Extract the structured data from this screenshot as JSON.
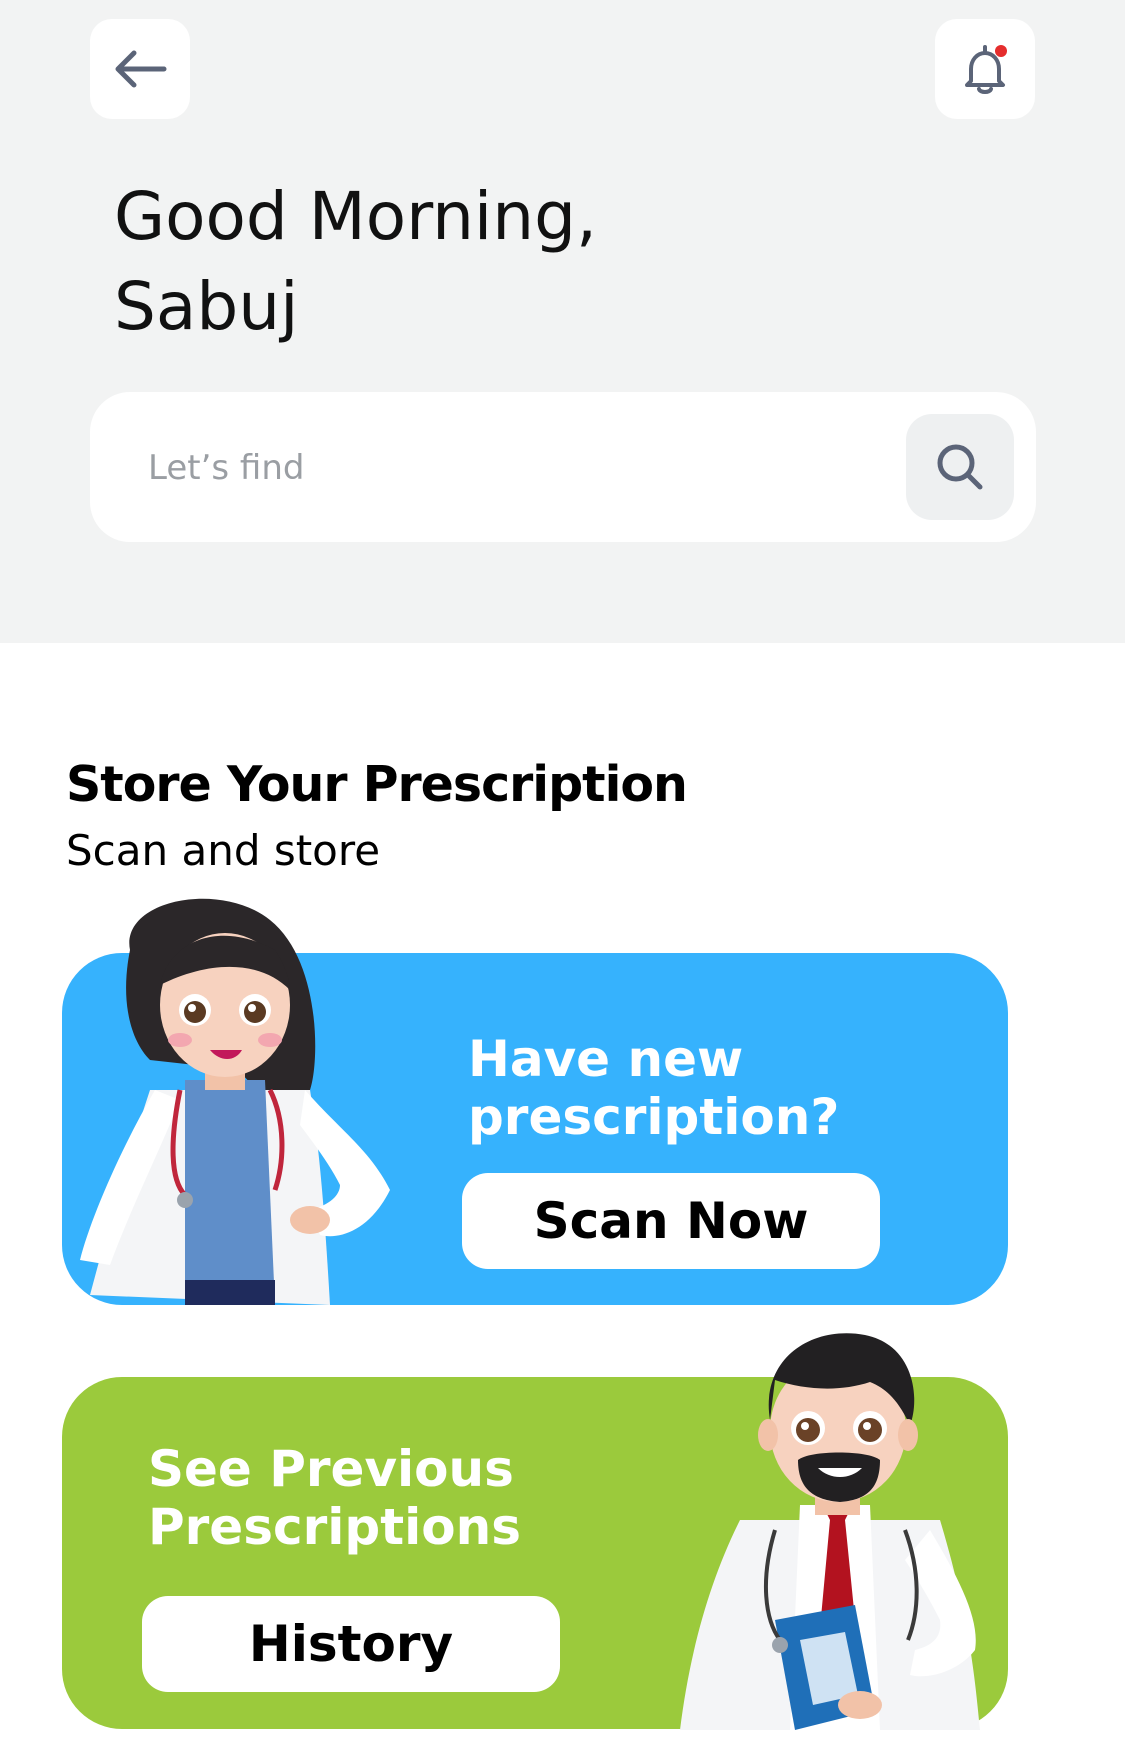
{
  "header": {
    "greeting_line1": "Good Morning,",
    "greeting_line2": "Sabuj",
    "back_icon": "arrow-left-icon",
    "notification_icon": "bell-icon"
  },
  "search": {
    "placeholder": "Let’s find",
    "icon": "search-icon"
  },
  "section": {
    "title": "Store Your Prescription",
    "subtitle": "Scan and store"
  },
  "scan_card": {
    "line1": "Have new",
    "line2": "prescription?",
    "button_label": "Scan Now",
    "illustration": "female-doctor-illustration"
  },
  "history_card": {
    "line1": "See Previous",
    "line2": "Prescriptions",
    "button_label": "History",
    "illustration": "male-doctor-illustration"
  },
  "colors": {
    "header_bg": "#f2f3f3",
    "scan_card_bg": "#36b2fd",
    "history_card_bg": "#9bca3c",
    "icon_color": "#5b6478",
    "notification_dot": "#e52d2d"
  }
}
